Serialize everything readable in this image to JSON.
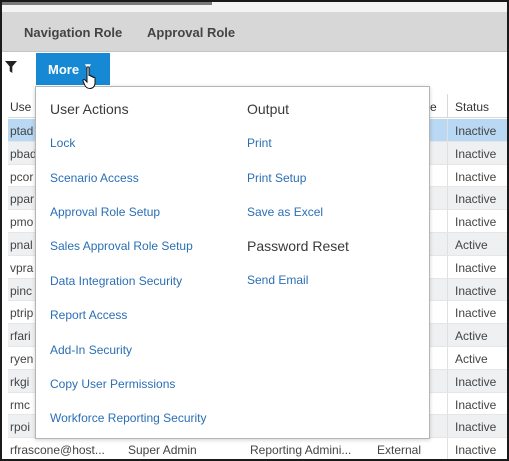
{
  "tabs": {
    "navigation_role": "Navigation Role",
    "approval_role": "Approval Role"
  },
  "toolbar": {
    "more_label": "More",
    "more_caret": "▼"
  },
  "grid": {
    "headers": {
      "user": "Use",
      "tail": "e",
      "status": "Status"
    },
    "rows": [
      {
        "user": "ptad",
        "status": "Inactive"
      },
      {
        "user": "pbad",
        "status": "Inactive"
      },
      {
        "user": "pcor",
        "status": "Inactive"
      },
      {
        "user": "ppar",
        "status": "Inactive"
      },
      {
        "user": "pmo",
        "status": "Inactive"
      },
      {
        "user": "pnal",
        "status": "Active"
      },
      {
        "user": "vpra",
        "status": "Inactive"
      },
      {
        "user": "pinc",
        "status": "Inactive"
      },
      {
        "user": "ptrip",
        "status": "Inactive"
      },
      {
        "user": "rfari",
        "status": "Active"
      },
      {
        "user": "ryen",
        "status": "Active"
      },
      {
        "user": "rkgi",
        "status": "Inactive"
      },
      {
        "user": "rmc",
        "status": "Inactive"
      },
      {
        "user": "rpoi",
        "status": "Inactive"
      },
      {
        "user": "rfrascone@host...",
        "nav_role": "Super Admin",
        "appr_role": "Reporting Admini...",
        "auth": "External",
        "status": "Inactive"
      }
    ]
  },
  "menu": {
    "user_actions_header": "User Actions",
    "user_actions": [
      "Lock",
      "Scenario Access",
      "Approval Role Setup",
      "Sales Approval Role Setup",
      "Data Integration Security",
      "Report Access",
      "Add-In Security",
      "Copy User Permissions",
      "Workforce Reporting Security"
    ],
    "output_header": "Output",
    "output": [
      "Print",
      "Print Setup",
      "Save as Excel"
    ],
    "password_reset_header": "Password Reset",
    "password_reset": [
      "Send Email"
    ]
  }
}
